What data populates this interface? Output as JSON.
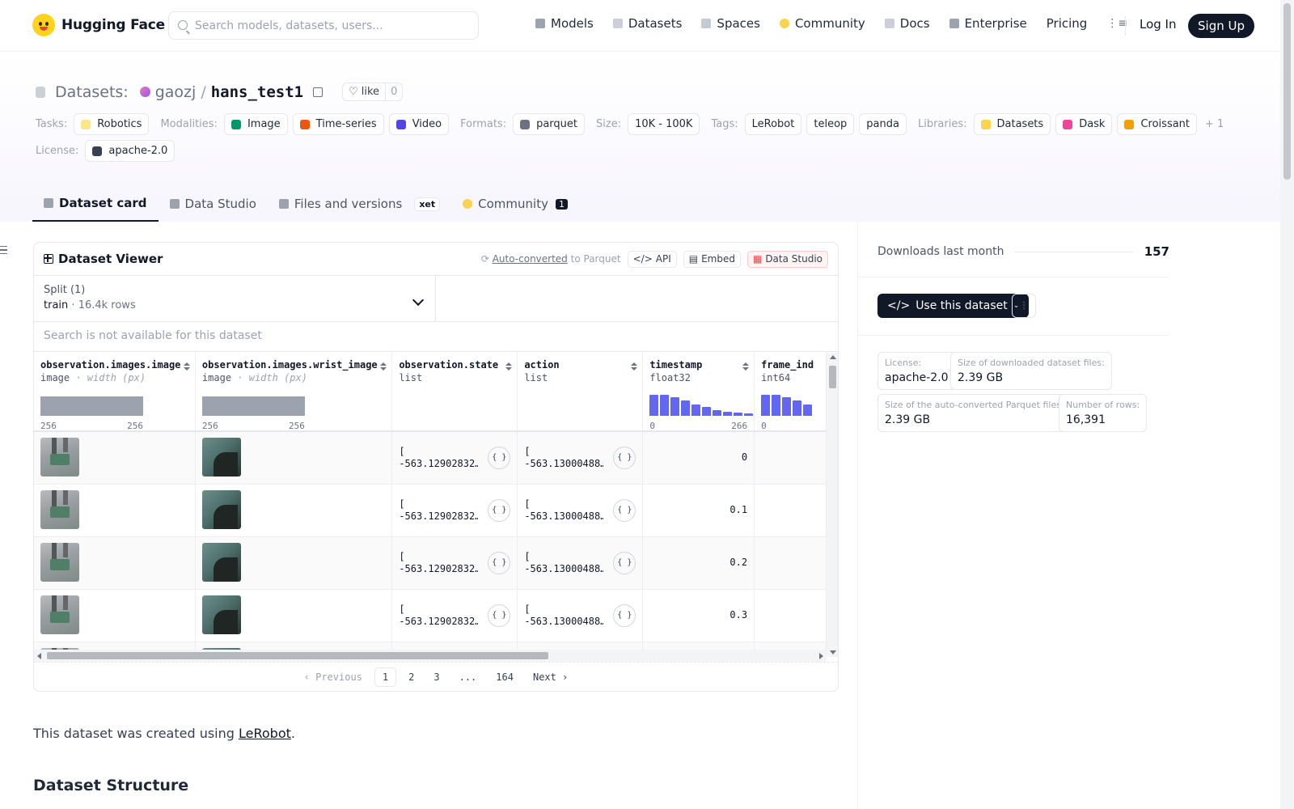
{
  "header": {
    "logo_text": "Hugging Face",
    "search_placeholder": "Search models, datasets, users...",
    "nav": [
      {
        "label": "Models",
        "icon": "cube-icon",
        "color": "#9ca3af"
      },
      {
        "label": "Datasets",
        "icon": "database-icon",
        "color": "#cbd0d8"
      },
      {
        "label": "Spaces",
        "icon": "grid-icon",
        "color": "#c4c9d2"
      },
      {
        "label": "Community",
        "icon": "smiley-icon",
        "color": "#fcd34d"
      },
      {
        "label": "Docs",
        "icon": "book-icon",
        "color": "#cbd0d8"
      },
      {
        "label": "Enterprise",
        "icon": "building-icon",
        "color": "#9ca3af"
      },
      {
        "label": "Pricing",
        "icon": "",
        "color": ""
      }
    ],
    "login": "Log In",
    "signup": "Sign Up"
  },
  "repo": {
    "type_label": "Datasets:",
    "user": "gaozj",
    "slash": "/",
    "name": "hans_test1",
    "like_label": "like",
    "like_count": "0",
    "tags": {
      "tasks_label": "Tasks:",
      "tasks": [
        "Robotics"
      ],
      "modalities_label": "Modalities:",
      "modalities": [
        "Image",
        "Time-series",
        "Video"
      ],
      "formats_label": "Formats:",
      "formats": [
        "parquet"
      ],
      "size_label": "Size:",
      "size": [
        "10K - 100K"
      ],
      "tags_label": "Tags:",
      "tags": [
        "LeRobot",
        "teleop",
        "panda"
      ],
      "libraries_label": "Libraries:",
      "libraries": [
        "Datasets",
        "Dask",
        "Croissant"
      ],
      "libraries_more": "+ 1",
      "license_label": "License:",
      "license": [
        "apache-2.0"
      ]
    },
    "tabs": [
      {
        "label": "Dataset card",
        "active": true
      },
      {
        "label": "Data Studio",
        "active": false
      },
      {
        "label": "Files and versions",
        "active": false,
        "badge": "xet"
      },
      {
        "label": "Community",
        "active": false,
        "count": "1"
      }
    ]
  },
  "viewer": {
    "title": "Dataset Viewer",
    "autoconv_link": "Auto-converted",
    "autoconv_rest": "to Parquet",
    "api": "API",
    "embed": "Embed",
    "studio": "Data Studio",
    "split_label": "Split (1)",
    "split_name": "train",
    "split_sep": "·",
    "split_rows": "16.4k rows",
    "search_disabled": "Search is not available for this dataset",
    "columns": [
      {
        "name": "observation.images.image",
        "type": "image",
        "sub": "· width (px)",
        "min": "256",
        "max": "256"
      },
      {
        "name": "observation.images.wrist_image",
        "type": "image",
        "sub": "· width (px)",
        "min": "256",
        "max": "256"
      },
      {
        "name": "observation.state",
        "type": "list"
      },
      {
        "name": "action",
        "type": "list"
      },
      {
        "name": "timestamp",
        "type": "float32",
        "min": "0",
        "max": "266",
        "hist": [
          0.85,
          0.85,
          0.78,
          0.62,
          0.48,
          0.38,
          0.22,
          0.16,
          0.14,
          0.1
        ]
      },
      {
        "name": "frame_ind",
        "type": "int64",
        "min": "0",
        "hist": [
          0.85,
          0.85,
          0.78,
          0.62,
          0.48
        ]
      }
    ],
    "rows": [
      {
        "state": "[\n-563.12902832…",
        "action": "[\n-563.13000488…",
        "timestamp": "0"
      },
      {
        "state": "[\n-563.12902832…",
        "action": "[\n-563.13000488…",
        "timestamp": "0.1"
      },
      {
        "state": "[\n-563.12902832…",
        "action": "[\n-563.13000488…",
        "timestamp": "0.2"
      },
      {
        "state": "[\n-563.12902832…",
        "action": "[\n-563.13000488…",
        "timestamp": "0.3"
      }
    ],
    "pager": {
      "prev": "Previous",
      "pages": [
        "1",
        "2",
        "3",
        "...",
        "164"
      ],
      "next": "Next"
    }
  },
  "card": {
    "desc_pre": "This dataset was created using ",
    "desc_link": "LeRobot",
    "desc_post": ".",
    "section": "Dataset Structure"
  },
  "sidebar": {
    "downloads_label": "Downloads last month",
    "downloads": "157",
    "use_btn": "Use this dataset",
    "info": [
      {
        "k": "License:",
        "v": "apache-2.0"
      },
      {
        "k": "Size of downloaded dataset files:",
        "v": "2.39 GB"
      },
      {
        "k": "Size of the auto-converted Parquet files:",
        "v": "2.39 GB"
      },
      {
        "k": "Number of rows:",
        "v": "16,391"
      }
    ]
  }
}
